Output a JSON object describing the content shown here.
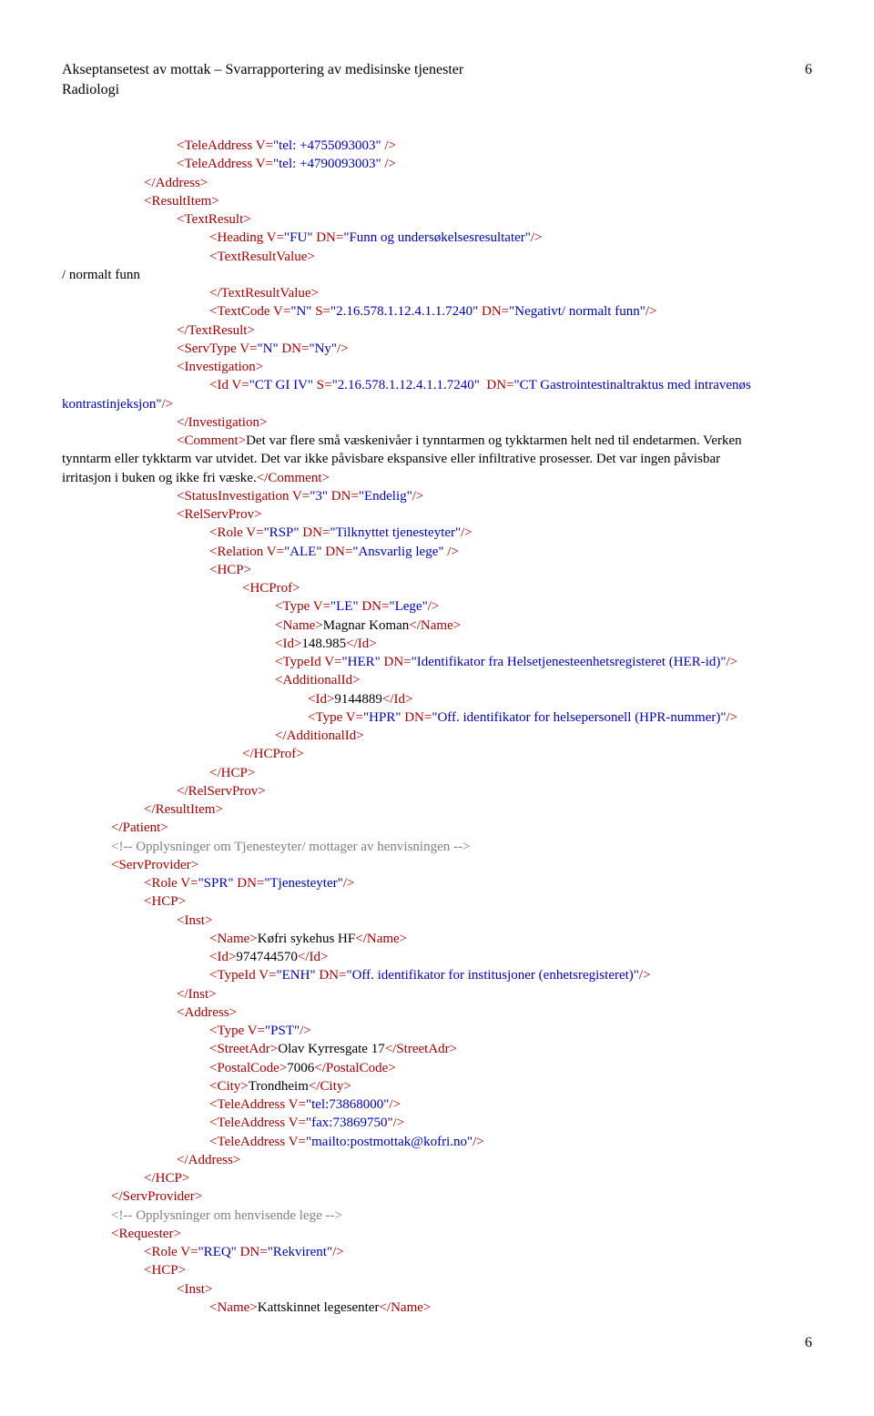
{
  "header": {
    "title": "Akseptansetest av mottak – Svarrapportering av medisinske tjenester",
    "subtitle": "Radiologi",
    "pagenum_top": "6",
    "pagenum_bottom": "6"
  },
  "lines": [
    {
      "indent": 3,
      "parts": [
        {
          "cls": "red",
          "t": "<TeleAddress V="
        },
        {
          "cls": "blue",
          "t": "\"tel: +4755093003\""
        },
        {
          "cls": "red",
          "t": " />"
        }
      ]
    },
    {
      "indent": 3,
      "parts": [
        {
          "cls": "red",
          "t": "<TeleAddress V="
        },
        {
          "cls": "blue",
          "t": "\"tel: +4790093003\""
        },
        {
          "cls": "red",
          "t": " />"
        }
      ]
    },
    {
      "indent": 2,
      "parts": [
        {
          "cls": "red",
          "t": "</Address>"
        }
      ]
    },
    {
      "indent": 2,
      "parts": [
        {
          "cls": "red",
          "t": "<ResultItem>"
        }
      ]
    },
    {
      "indent": 3,
      "parts": [
        {
          "cls": "red",
          "t": "<TextResult>"
        }
      ]
    },
    {
      "indent": 4,
      "parts": [
        {
          "cls": "red",
          "t": "<Heading V="
        },
        {
          "cls": "blue",
          "t": "\"FU\""
        },
        {
          "cls": "red",
          "t": " DN="
        },
        {
          "cls": "blue",
          "t": "\"Funn og undersøkelsesresultater\""
        },
        {
          "cls": "red",
          "t": "/>"
        }
      ]
    },
    {
      "indent": 4,
      "parts": [
        {
          "cls": "red",
          "t": "<TextResultValue>"
        }
      ]
    },
    {
      "indent": 0,
      "parts": [
        {
          "cls": "black",
          "t": "/ normalt funn"
        }
      ]
    },
    {
      "indent": 4,
      "parts": [
        {
          "cls": "red",
          "t": "</TextResultValue>"
        }
      ]
    },
    {
      "indent": 4,
      "parts": [
        {
          "cls": "red",
          "t": "<TextCode V="
        },
        {
          "cls": "blue",
          "t": "\"N\""
        },
        {
          "cls": "red",
          "t": " S="
        },
        {
          "cls": "blue",
          "t": "\"2.16.578.1.12.4.1.1.7240\""
        },
        {
          "cls": "red",
          "t": " DN="
        },
        {
          "cls": "blue",
          "t": "\"Negativt/ normalt funn\""
        },
        {
          "cls": "red",
          "t": "/>"
        }
      ]
    },
    {
      "indent": 3,
      "parts": [
        {
          "cls": "red",
          "t": "</TextResult>"
        }
      ]
    },
    {
      "indent": 3,
      "parts": [
        {
          "cls": "red",
          "t": "<ServType V="
        },
        {
          "cls": "blue",
          "t": "\"N\""
        },
        {
          "cls": "red",
          "t": " DN="
        },
        {
          "cls": "blue",
          "t": "\"Ny\""
        },
        {
          "cls": "red",
          "t": "/>"
        }
      ]
    },
    {
      "indent": 3,
      "parts": [
        {
          "cls": "red",
          "t": "<Investigation>"
        }
      ]
    },
    {
      "indent": 4,
      "parts": [
        {
          "cls": "red",
          "t": "<Id V="
        },
        {
          "cls": "blue",
          "t": "\"CT GI IV\""
        },
        {
          "cls": "red",
          "t": " S="
        },
        {
          "cls": "blue",
          "t": "\"2.16.578.1.12.4.1.1.7240\""
        },
        {
          "cls": "red",
          "t": "  DN="
        },
        {
          "cls": "blue",
          "t": "\"CT Gastrointestinaltraktus med intravenøs"
        }
      ]
    },
    {
      "indent": 0,
      "parts": [
        {
          "cls": "blue",
          "t": "kontrastinjeksjon\""
        },
        {
          "cls": "red",
          "t": "/>"
        }
      ]
    },
    {
      "indent": 3,
      "parts": [
        {
          "cls": "red",
          "t": "</Investigation>"
        }
      ]
    },
    {
      "indent": 3,
      "parts": [
        {
          "cls": "red",
          "t": "<Comment>"
        },
        {
          "cls": "black",
          "t": "Det var flere små væskenivåer i tynntarmen og tykktarmen helt ned til endetarmen. Verken"
        }
      ]
    },
    {
      "indent": 0,
      "parts": [
        {
          "cls": "black",
          "t": "tynntarm eller tykktarm var utvidet. Det var ikke påvisbare ekspansive eller infiltrative prosesser. Det var ingen påvisbar"
        }
      ]
    },
    {
      "indent": 0,
      "parts": [
        {
          "cls": "black",
          "t": "irritasjon i buken og ikke fri væske."
        },
        {
          "cls": "red",
          "t": "</Comment>"
        }
      ]
    },
    {
      "indent": 3,
      "parts": [
        {
          "cls": "red",
          "t": "<StatusInvestigation V="
        },
        {
          "cls": "blue",
          "t": "\"3\""
        },
        {
          "cls": "red",
          "t": " DN="
        },
        {
          "cls": "blue",
          "t": "\"Endelig\""
        },
        {
          "cls": "red",
          "t": "/>"
        }
      ]
    },
    {
      "indent": 3,
      "parts": [
        {
          "cls": "red",
          "t": "<RelServProv>"
        }
      ]
    },
    {
      "indent": 4,
      "parts": [
        {
          "cls": "red",
          "t": "<Role V="
        },
        {
          "cls": "blue",
          "t": "\"RSP\""
        },
        {
          "cls": "red",
          "t": " DN="
        },
        {
          "cls": "blue",
          "t": "\"Tilknyttet tjenesteyter\""
        },
        {
          "cls": "red",
          "t": "/>"
        }
      ]
    },
    {
      "indent": 4,
      "parts": [
        {
          "cls": "red",
          "t": "<Relation V="
        },
        {
          "cls": "blue",
          "t": "\"ALE\""
        },
        {
          "cls": "red",
          "t": " DN="
        },
        {
          "cls": "blue",
          "t": "\"Ansvarlig lege\""
        },
        {
          "cls": "red",
          "t": " />"
        }
      ]
    },
    {
      "indent": 4,
      "parts": [
        {
          "cls": "red",
          "t": "<HCP>"
        }
      ]
    },
    {
      "indent": 5,
      "parts": [
        {
          "cls": "red",
          "t": "<HCProf>"
        }
      ]
    },
    {
      "indent": 6,
      "parts": [
        {
          "cls": "red",
          "t": "<Type V="
        },
        {
          "cls": "blue",
          "t": "\"LE\""
        },
        {
          "cls": "red",
          "t": " DN="
        },
        {
          "cls": "blue",
          "t": "\"Lege\""
        },
        {
          "cls": "red",
          "t": "/>"
        }
      ]
    },
    {
      "indent": 6,
      "parts": [
        {
          "cls": "red",
          "t": "<Name>"
        },
        {
          "cls": "black",
          "t": "Magnar Koman"
        },
        {
          "cls": "red",
          "t": "</Name>"
        }
      ]
    },
    {
      "indent": 6,
      "parts": [
        {
          "cls": "red",
          "t": "<Id>"
        },
        {
          "cls": "black",
          "t": "148.985"
        },
        {
          "cls": "red",
          "t": "</Id>"
        }
      ]
    },
    {
      "indent": 6,
      "parts": [
        {
          "cls": "red",
          "t": "<TypeId V="
        },
        {
          "cls": "blue",
          "t": "\"HER\""
        },
        {
          "cls": "red",
          "t": " DN="
        },
        {
          "cls": "blue",
          "t": "\"Identifikator fra Helsetjenesteenhetsregisteret (HER-id)\""
        },
        {
          "cls": "red",
          "t": "/>"
        }
      ]
    },
    {
      "indent": 6,
      "parts": [
        {
          "cls": "red",
          "t": "<AdditionalId>"
        }
      ]
    },
    {
      "indent": 7,
      "raw_indent": 270,
      "parts": [
        {
          "cls": "red",
          "t": "<Id>"
        },
        {
          "cls": "black",
          "t": "9144889"
        },
        {
          "cls": "red",
          "t": "</Id>"
        }
      ]
    },
    {
      "indent": 7,
      "raw_indent": 270,
      "parts": [
        {
          "cls": "red",
          "t": "<Type V="
        },
        {
          "cls": "blue",
          "t": "\"HPR\""
        },
        {
          "cls": "red",
          "t": " DN="
        },
        {
          "cls": "blue",
          "t": "\"Off. identifikator for helsepersonell (HPR-nummer)\""
        },
        {
          "cls": "red",
          "t": "/>"
        }
      ]
    },
    {
      "indent": 6,
      "parts": [
        {
          "cls": "red",
          "t": "</AdditionalId>"
        }
      ]
    },
    {
      "indent": 5,
      "parts": [
        {
          "cls": "red",
          "t": "</HCProf>"
        }
      ]
    },
    {
      "indent": 4,
      "parts": [
        {
          "cls": "red",
          "t": "</HCP>"
        }
      ]
    },
    {
      "indent": 3,
      "parts": [
        {
          "cls": "red",
          "t": "</RelServProv>"
        }
      ]
    },
    {
      "indent": 2,
      "parts": [
        {
          "cls": "red",
          "t": "</ResultItem>"
        }
      ]
    },
    {
      "indent": 1,
      "parts": [
        {
          "cls": "red",
          "t": "</Patient>"
        }
      ]
    },
    {
      "indent": 1,
      "parts": [
        {
          "cls": "cm",
          "t": "<!-- Opplysninger om Tjenesteyter/ mottager av henvisningen -->"
        }
      ]
    },
    {
      "indent": 1,
      "parts": [
        {
          "cls": "red",
          "t": "<ServProvider>"
        }
      ]
    },
    {
      "indent": 2,
      "parts": [
        {
          "cls": "red",
          "t": "<Role V="
        },
        {
          "cls": "blue",
          "t": "\"SPR\""
        },
        {
          "cls": "red",
          "t": " DN="
        },
        {
          "cls": "blue",
          "t": "\"Tjenesteyter\""
        },
        {
          "cls": "red",
          "t": "/>"
        }
      ]
    },
    {
      "indent": 2,
      "parts": [
        {
          "cls": "red",
          "t": "<HCP>"
        }
      ]
    },
    {
      "indent": 3,
      "parts": [
        {
          "cls": "red",
          "t": "<Inst>"
        }
      ]
    },
    {
      "indent": 4,
      "parts": [
        {
          "cls": "red",
          "t": "<Name>"
        },
        {
          "cls": "black",
          "t": "Køfri sykehus HF"
        },
        {
          "cls": "red",
          "t": "</Name>"
        }
      ]
    },
    {
      "indent": 4,
      "parts": [
        {
          "cls": "red",
          "t": "<Id>"
        },
        {
          "cls": "black",
          "t": "974744570"
        },
        {
          "cls": "red",
          "t": "</Id>"
        }
      ]
    },
    {
      "indent": 4,
      "parts": [
        {
          "cls": "red",
          "t": "<TypeId V="
        },
        {
          "cls": "blue",
          "t": "\"ENH\""
        },
        {
          "cls": "red",
          "t": " DN="
        },
        {
          "cls": "blue",
          "t": "\"Off. identifikator for institusjoner (enhetsregisteret)\""
        },
        {
          "cls": "red",
          "t": "/>"
        }
      ]
    },
    {
      "indent": 3,
      "parts": [
        {
          "cls": "red",
          "t": "</Inst>"
        }
      ]
    },
    {
      "indent": 3,
      "parts": [
        {
          "cls": "red",
          "t": "<Address>"
        }
      ]
    },
    {
      "indent": 4,
      "parts": [
        {
          "cls": "red",
          "t": "<Type V="
        },
        {
          "cls": "blue",
          "t": "\"PST\""
        },
        {
          "cls": "red",
          "t": "/>"
        }
      ]
    },
    {
      "indent": 4,
      "parts": [
        {
          "cls": "red",
          "t": "<StreetAdr>"
        },
        {
          "cls": "black",
          "t": "Olav Kyrresgate 17"
        },
        {
          "cls": "red",
          "t": "</StreetAdr>"
        }
      ]
    },
    {
      "indent": 4,
      "parts": [
        {
          "cls": "red",
          "t": "<PostalCode>"
        },
        {
          "cls": "black",
          "t": "7006"
        },
        {
          "cls": "red",
          "t": "</PostalCode>"
        }
      ]
    },
    {
      "indent": 4,
      "parts": [
        {
          "cls": "red",
          "t": "<City>"
        },
        {
          "cls": "black",
          "t": "Trondheim"
        },
        {
          "cls": "red",
          "t": "</City>"
        }
      ]
    },
    {
      "indent": 4,
      "parts": [
        {
          "cls": "red",
          "t": "<TeleAddress V="
        },
        {
          "cls": "blue",
          "t": "\"tel:73868000\""
        },
        {
          "cls": "red",
          "t": "/>"
        }
      ]
    },
    {
      "indent": 4,
      "parts": [
        {
          "cls": "red",
          "t": "<TeleAddress V="
        },
        {
          "cls": "blue",
          "t": "\"fax:73869750\""
        },
        {
          "cls": "red",
          "t": "/>"
        }
      ]
    },
    {
      "indent": 4,
      "parts": [
        {
          "cls": "red",
          "t": "<TeleAddress V="
        },
        {
          "cls": "blue",
          "t": "\"mailto:postmottak@kofri.no\""
        },
        {
          "cls": "red",
          "t": "/>"
        }
      ]
    },
    {
      "indent": 3,
      "parts": [
        {
          "cls": "red",
          "t": "</Address>"
        }
      ]
    },
    {
      "indent": 2,
      "parts": [
        {
          "cls": "red",
          "t": "</HCP>"
        }
      ]
    },
    {
      "indent": 1,
      "parts": [
        {
          "cls": "red",
          "t": "</ServProvider>"
        }
      ]
    },
    {
      "indent": 1,
      "parts": [
        {
          "cls": "cm",
          "t": "<!-- Opplysninger om henvisende lege -->"
        }
      ]
    },
    {
      "indent": 1,
      "parts": [
        {
          "cls": "red",
          "t": "<Requester>"
        }
      ]
    },
    {
      "indent": 2,
      "parts": [
        {
          "cls": "red",
          "t": "<Role V="
        },
        {
          "cls": "blue",
          "t": "\"REQ\""
        },
        {
          "cls": "red",
          "t": " DN="
        },
        {
          "cls": "blue",
          "t": "\"Rekvirent\""
        },
        {
          "cls": "red",
          "t": "/>"
        }
      ]
    },
    {
      "indent": 2,
      "parts": [
        {
          "cls": "red",
          "t": "<HCP>"
        }
      ]
    },
    {
      "indent": 3,
      "parts": [
        {
          "cls": "red",
          "t": "<Inst>"
        }
      ]
    },
    {
      "indent": 4,
      "parts": [
        {
          "cls": "red",
          "t": "<Name>"
        },
        {
          "cls": "black",
          "t": "Kattskinnet legesenter"
        },
        {
          "cls": "red",
          "t": "</Name>"
        }
      ]
    }
  ]
}
